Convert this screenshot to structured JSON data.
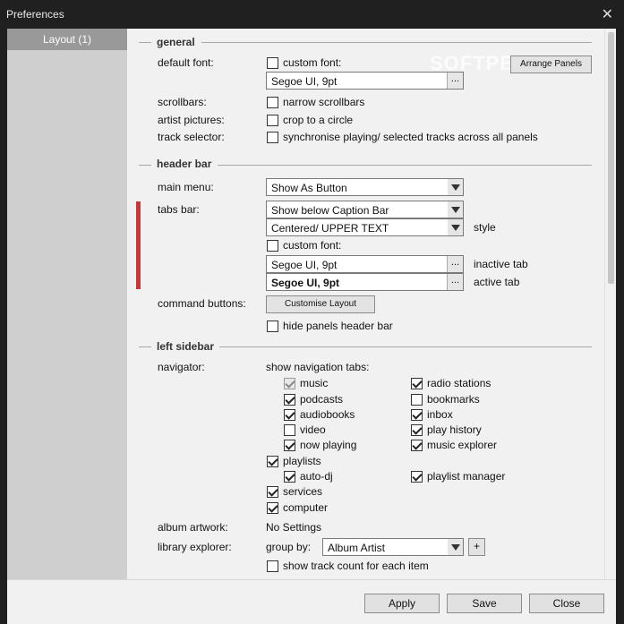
{
  "window": {
    "title": "Preferences",
    "close_symbol": "✕"
  },
  "watermark": "SOFTPEDIA",
  "sidebar": {
    "items": [
      {
        "label": "Layout (1)",
        "selected": true
      }
    ]
  },
  "general": {
    "title": "general",
    "default_font_label": "default font:",
    "custom_font_label": "custom font:",
    "custom_font_checked": false,
    "font_value": "Segoe UI, 9pt",
    "font_dots": "...",
    "arrange_panels_label": "Arrange Panels",
    "scrollbars_label": "scrollbars:",
    "narrow_scrollbars_label": "narrow scrollbars",
    "narrow_scrollbars_checked": false,
    "artist_pictures_label": "artist pictures:",
    "crop_circle_label": "crop to a circle",
    "crop_circle_checked": false,
    "track_selector_label": "track selector:",
    "sync_label": "synchronise playing/ selected tracks across all panels",
    "sync_checked": false
  },
  "header_bar": {
    "title": "header bar",
    "main_menu_label": "main menu:",
    "main_menu_value": "Show As Button",
    "tabs_bar_label": "tabs bar:",
    "tabs_bar_value": "Show below Caption Bar",
    "style_value": "Centered/ UPPER TEXT",
    "style_label": "style",
    "custom_font_label": "custom font:",
    "custom_font_checked": false,
    "inactive_font_value": "Segoe UI, 9pt",
    "inactive_tab_label": "inactive tab",
    "active_font_value": "Segoe UI, 9pt",
    "active_tab_label": "active tab",
    "dots": "...",
    "command_buttons_label": "command buttons:",
    "customise_layout_label": "Customise Layout",
    "hide_header_label": "hide panels header bar",
    "hide_header_checked": false
  },
  "left_sidebar": {
    "title": "left sidebar",
    "navigator_label": "navigator:",
    "show_tabs_label": "show navigation tabs:",
    "tabs_left": [
      {
        "label": "music",
        "checked": true,
        "disabled": true
      },
      {
        "label": "podcasts",
        "checked": true
      },
      {
        "label": "audiobooks",
        "checked": true
      },
      {
        "label": "video",
        "checked": false
      },
      {
        "label": "now playing",
        "checked": true
      }
    ],
    "tabs_right": [
      {
        "label": "radio stations",
        "checked": true
      },
      {
        "label": "bookmarks",
        "checked": false
      },
      {
        "label": "inbox",
        "checked": true
      },
      {
        "label": "play history",
        "checked": true
      },
      {
        "label": "music explorer",
        "checked": true
      }
    ],
    "playlists": {
      "label": "playlists",
      "checked": true
    },
    "auto_dj": {
      "label": "auto-dj",
      "checked": true
    },
    "playlist_manager": {
      "label": "playlist manager",
      "checked": true
    },
    "services": {
      "label": "services",
      "checked": true
    },
    "computer": {
      "label": "computer",
      "checked": true
    },
    "album_artwork_label": "album artwork:",
    "album_artwork_value": "No Settings",
    "library_explorer_label": "library explorer:",
    "group_by_label": "group by:",
    "group_by_value": "Album Artist",
    "plus": "+",
    "show_track_count_label": "show track count for each item",
    "show_track_count_checked": false
  },
  "footer": {
    "apply": "Apply",
    "save": "Save",
    "close": "Close"
  }
}
